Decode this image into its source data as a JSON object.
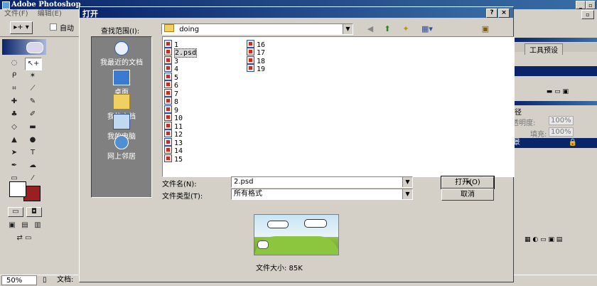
{
  "app": {
    "title": "Adobe Photoshop",
    "menu": [
      "文件(F)",
      "编辑(E)"
    ],
    "options": {
      "auto_label": "自动"
    },
    "right_panels": {
      "tool_presets_tab": "工具预设",
      "paths_tab": "径",
      "opacity_label": "透明度:",
      "opacity_value": "100%",
      "fill_label": "填充:",
      "fill_value": "100%",
      "layer_name": "景"
    },
    "status": {
      "zoom": "50%",
      "doc_label": "文档:"
    },
    "foreground_color": "#ffffff",
    "background_color": "#9a2020"
  },
  "dialog": {
    "title": "打开",
    "look_in_label": "查找范围(I):",
    "look_in_value": "doing",
    "places": [
      "我最近的文档",
      "桌面",
      "我的文档",
      "我的电脑",
      "网上邻居"
    ],
    "files_col1": [
      "1",
      "2.psd",
      "3",
      "4",
      "5",
      "6",
      "7",
      "8",
      "9",
      "10",
      "11",
      "12",
      "13",
      "14",
      "15"
    ],
    "files_col2": [
      "16",
      "17",
      "18",
      "19"
    ],
    "selected_file": "2.psd",
    "filename_label": "文件名(N):",
    "filename_value": "2.psd",
    "filetype_label": "文件类型(T):",
    "filetype_value": "所有格式",
    "open_button": "打开(O)",
    "cancel_button": "取消",
    "filesize_label": "文件大小: 85K"
  }
}
